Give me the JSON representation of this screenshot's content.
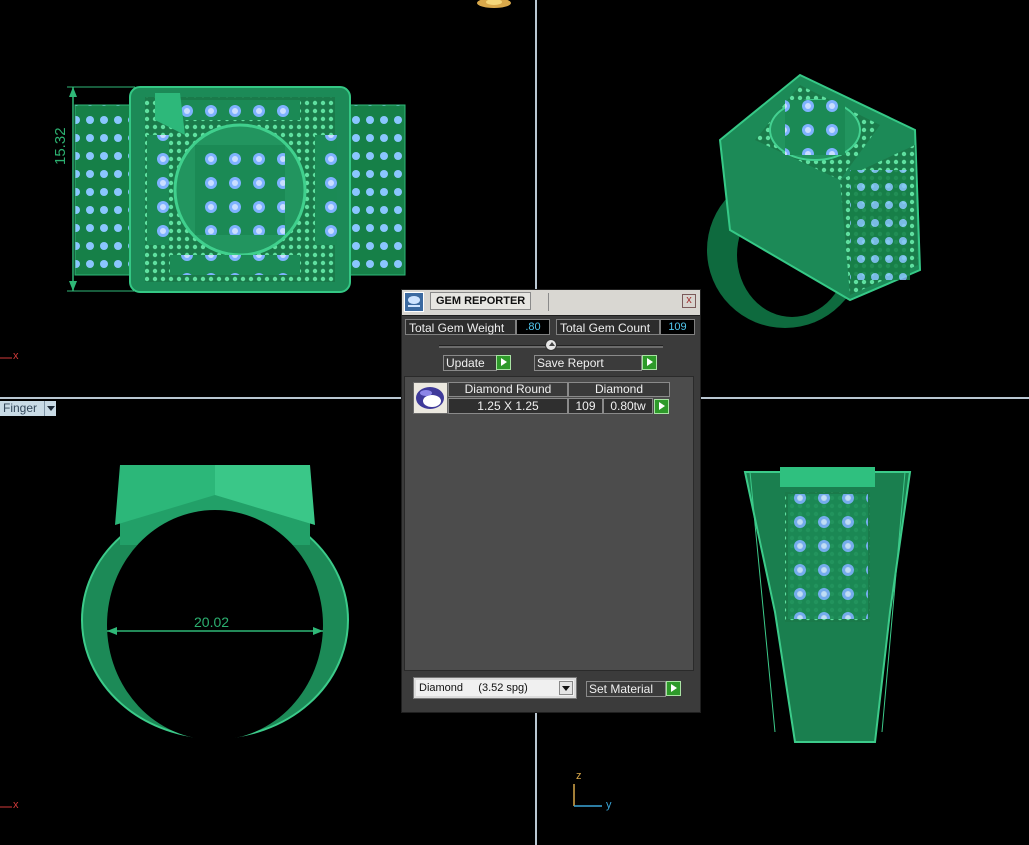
{
  "viewport": {
    "dimension_top": "15.32",
    "dimension_front": "20.02",
    "axis_x_top": "x",
    "axis_x_bottom": "x",
    "axis_z": "z",
    "axis_y": "y",
    "view_label": "Finger",
    "ring_color": "#1c8a57",
    "gem_color": "#7fb2ff"
  },
  "gem_reporter": {
    "title": "GEM REPORTER",
    "close": "x",
    "total_weight_label": "Total Gem Weight",
    "total_weight_value": ".80",
    "total_count_label": "Total Gem Count",
    "total_count_value": "109",
    "update_label": "Update",
    "save_report_label": "Save Report",
    "rows": [
      {
        "shape": "Diamond Round",
        "size": "1.25 X 1.25",
        "material": "Diamond",
        "count": "109",
        "weight": "0.80tw"
      }
    ],
    "material_select": "Diamond     (3.52 spg)",
    "set_material_label": "Set Material"
  }
}
